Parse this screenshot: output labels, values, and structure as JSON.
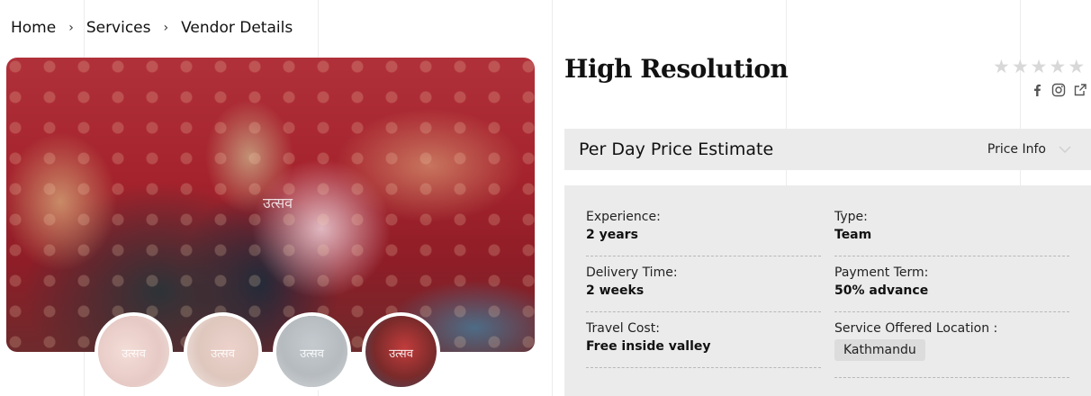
{
  "breadcrumb": [
    {
      "label": "Home"
    },
    {
      "label": "Services"
    },
    {
      "label": "Vendor Details"
    }
  ],
  "breadcrumb_separator": "›",
  "hero": {
    "watermark": "उत्सव",
    "thumbnails": [
      {
        "watermark": "उत्सव",
        "active": false
      },
      {
        "watermark": "उत्सव",
        "active": false
      },
      {
        "watermark": "उत्सव",
        "active": false
      },
      {
        "watermark": "उत्सव",
        "active": true
      }
    ]
  },
  "vendor": {
    "name": "High Resolution",
    "rating": {
      "value": 0,
      "max": 5,
      "star_color": "#d8d8d8"
    }
  },
  "social_icons": [
    "facebook-icon",
    "instagram-icon",
    "external-link-icon"
  ],
  "price": {
    "title": "Per Day Price Estimate",
    "info_label": "Price Info"
  },
  "details": {
    "experience_label": "Experience:",
    "experience_value": "2 years",
    "type_label": "Type:",
    "type_value": "Team",
    "delivery_label": "Delivery Time:",
    "delivery_value": "2 weeks",
    "payment_label": "Payment Term:",
    "payment_value": "50% advance",
    "travel_label": "Travel Cost:",
    "travel_value": "Free inside valley",
    "location_label": "Service Offered Location :",
    "location_value": "Kathmandu"
  },
  "colors": {
    "panel_bg": "#ebebeb",
    "chip_bg": "#dcdcdc",
    "text": "#111111"
  }
}
